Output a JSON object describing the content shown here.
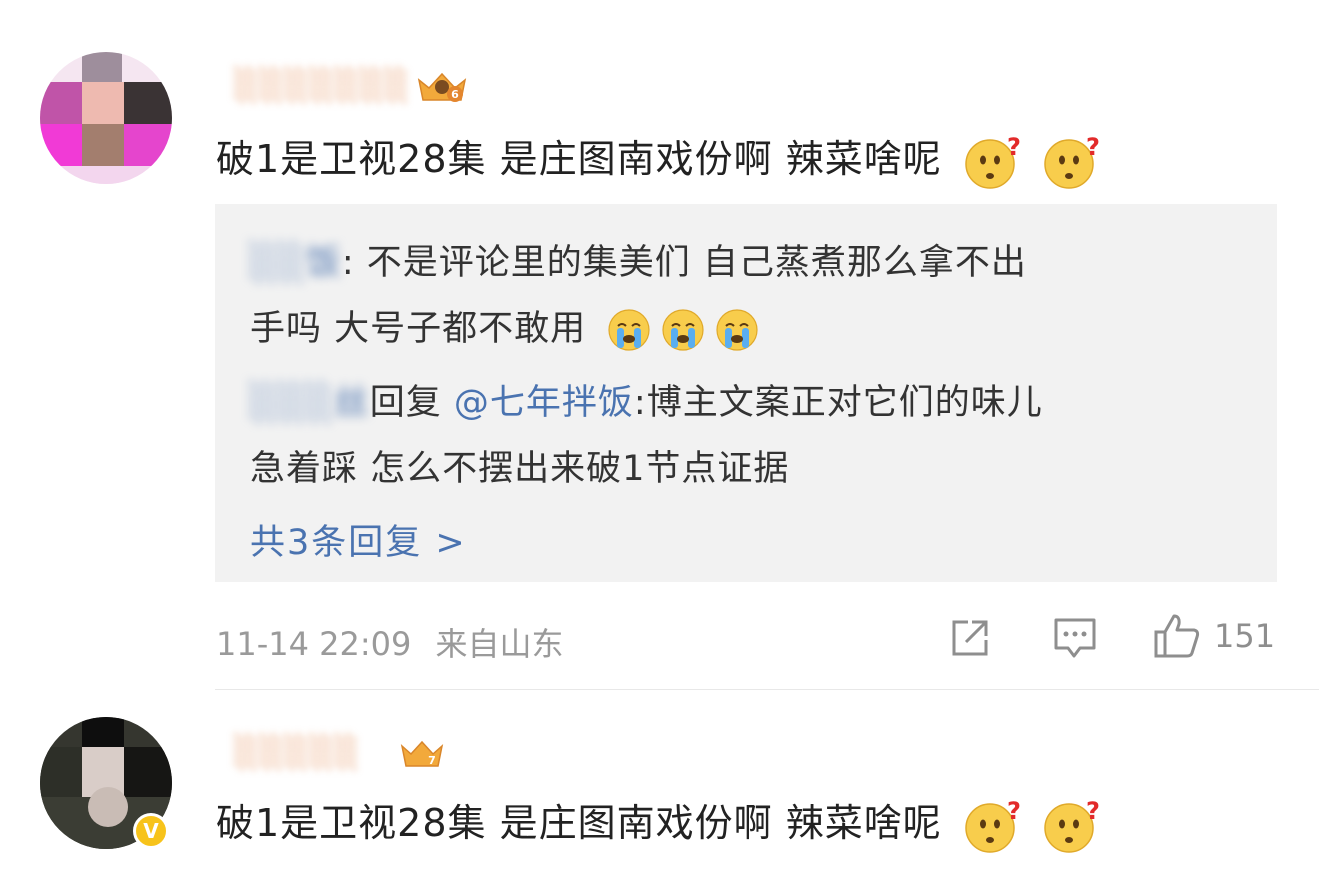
{
  "comments": [
    {
      "username": "░░░░░░░",
      "level": "6",
      "text": "破1是卫视28集 是庄图南戏份啊 辣菜啥呢",
      "emojis": [
        "thinking-question-emoji",
        "thinking-question-emoji"
      ],
      "replies": [
        {
          "author": "░░饭",
          "separator": ":",
          "text_line1": " 不是评论里的集美们 自己蒸煮那么拿不出",
          "text_line2": "手吗 大号子都不敢用",
          "emojis": [
            "crying-face-emoji",
            "crying-face-emoji",
            "crying-face-emoji"
          ]
        },
        {
          "author": "░░░丝",
          "reply_word": "回复",
          "mention": "@七年拌饭",
          "text_line1": ":博主文案正对它们的味儿",
          "text_line2": "急着踩 怎么不摆出来破1节点证据"
        }
      ],
      "more_replies": "共3条回复 >",
      "timestamp": "11-14 22:09",
      "location": "来自山东",
      "like_count": "151"
    },
    {
      "username": "░░░░░",
      "level": "7",
      "text": "破1是卫视28集 是庄图南戏份啊 辣菜啥呢",
      "emojis": [
        "thinking-question-emoji",
        "thinking-question-emoji"
      ],
      "verified_badge": "V"
    }
  ]
}
